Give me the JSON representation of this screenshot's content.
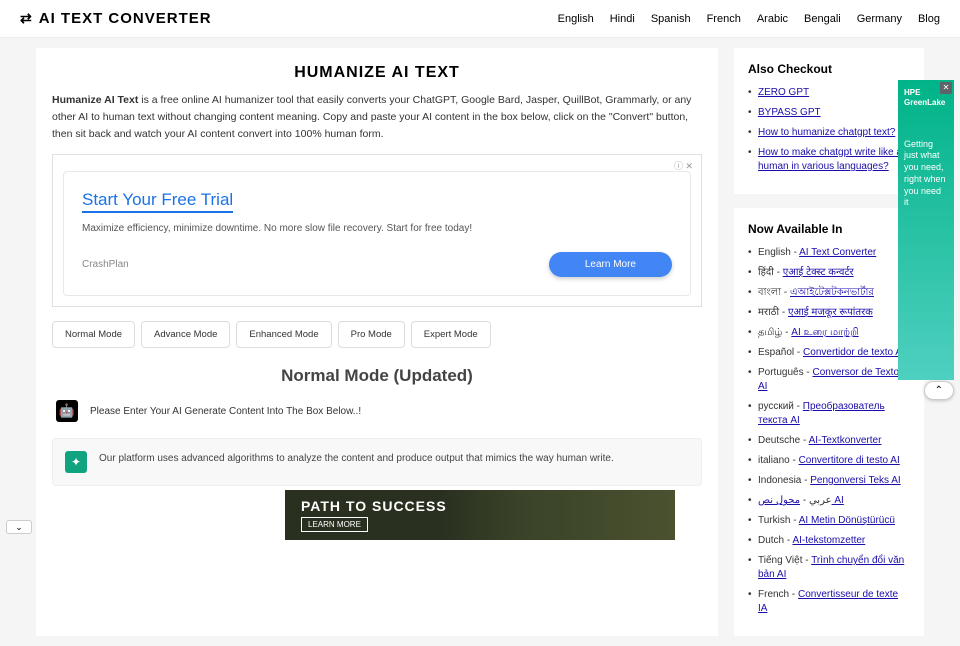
{
  "header": {
    "logo": "AI TEXT CONVERTER",
    "nav": [
      "English",
      "Hindi",
      "Spanish",
      "French",
      "Arabic",
      "Bengali",
      "Germany",
      "Blog"
    ]
  },
  "main": {
    "title": "HUMANIZE AI TEXT",
    "intro_bold": "Humanize AI Text",
    "intro_rest": " is a free online AI humanizer tool that easily converts your ChatGPT, Google Bard, Jasper, QuillBot, Grammarly, or any other AI to human text without changing content meaning. Copy and paste your AI content in the box below, click on the \"Convert\" button, then sit back and watch your AI content convert into 100% human form.",
    "ad": {
      "ad_label": "ⓘ ✕",
      "title": "Start Your Free Trial",
      "desc": "Maximize efficiency, minimize downtime. No more slow file recovery. Start for free today!",
      "brand": "CrashPlan",
      "button": "Learn More"
    },
    "modes": [
      "Normal Mode",
      "Advance Mode",
      "Enhanced Mode",
      "Pro Mode",
      "Expert Mode"
    ],
    "mode_title": "Normal Mode (Updated)",
    "prompt": "Please Enter Your AI Generate Content Into The Box Below..!",
    "info": "Our platform uses advanced algorithms to analyze the content and produce output that mimics the way human write."
  },
  "sidebar": {
    "checkout_title": "Also Checkout",
    "checkout_links": [
      "ZERO GPT",
      "BYPASS GPT",
      "How to humanize chatgpt text?",
      "How to make chatgpt write like a human in various languages?"
    ],
    "avail_title": "Now Available In",
    "languages": [
      {
        "pre": "English - ",
        "link": "AI Text Converter"
      },
      {
        "pre": "हिंदी - ",
        "link": "एआई टेक्स्ट कन्वर्टर"
      },
      {
        "pre": "বাংলা - ",
        "link": "এআইটেক্সটকনভার্টার"
      },
      {
        "pre": "मराठी - ",
        "link": "एआई मजकूर रूपांतरक"
      },
      {
        "pre": "தமிழ் - ",
        "link": "AI உரை மாற்றி"
      },
      {
        "pre": "Español - ",
        "link": "Convertidor de texto AI"
      },
      {
        "pre": "Português - ",
        "link": "Conversor de Texto AI"
      },
      {
        "pre": "русский - ",
        "link": "Преобразователь текста AI"
      },
      {
        "pre": "Deutsche - ",
        "link": "AI-Textkonverter"
      },
      {
        "pre": "italiano - ",
        "link": "Convertitore di testo AI"
      },
      {
        "pre": "Indonesia - ",
        "link": "Pengonversi Teks AI"
      },
      {
        "pre": "عربي - ",
        "link": "محول نص AI"
      },
      {
        "pre": "Turkish - ",
        "link": "AI Metin Dönüştürücü"
      },
      {
        "pre": "Dutch - ",
        "link": "AI-tekstomzetter"
      },
      {
        "pre": "Tiếng Việt - ",
        "link": "Trình chuyển đổi văn bản AI"
      },
      {
        "pre": "French - ",
        "link": "Convertisseur de texte IA"
      }
    ]
  },
  "right_ad": {
    "brand": "HPE GreenLake",
    "text": "Getting just what you need, right when you need it"
  },
  "bottom_ad": {
    "title": "PATH TO SUCCESS",
    "sub": "LEARN MORE"
  }
}
